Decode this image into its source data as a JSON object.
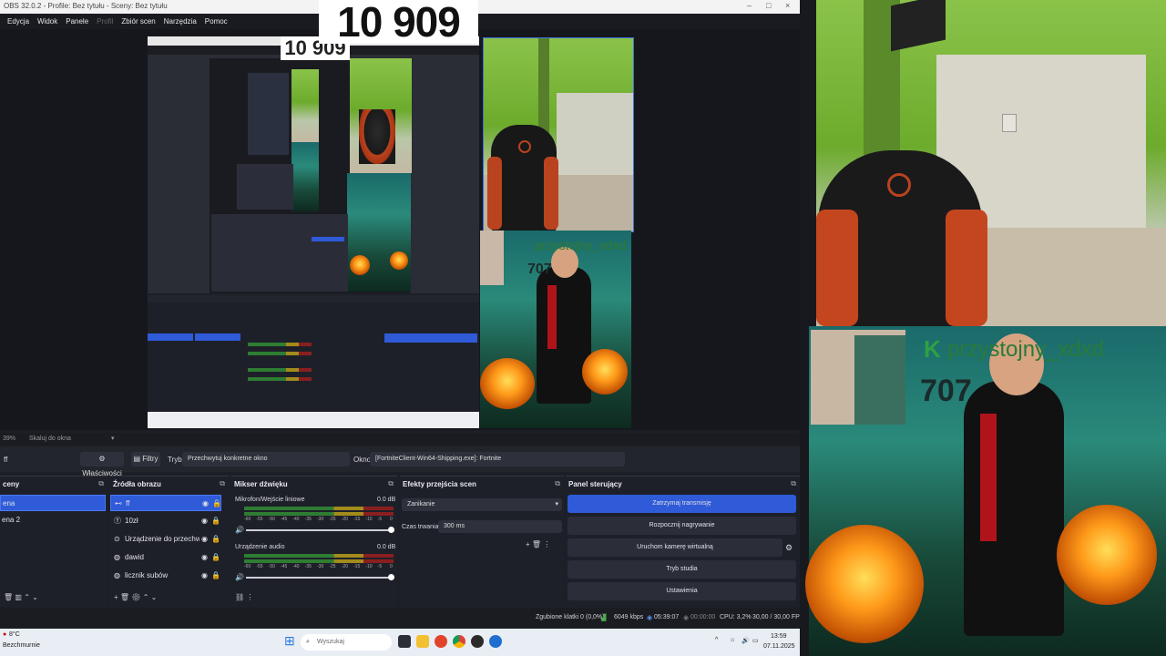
{
  "window": {
    "title": "OBS 32.0.2 - Profile: Bez tytułu - Sceny: Bez tytułu",
    "controls": [
      "–",
      "□",
      "×"
    ]
  },
  "menu": {
    "items": [
      "Edycja",
      "Widok",
      "Panele",
      "Profil",
      "Zbiór scen",
      "Narzędzia",
      "Pomoc"
    ]
  },
  "overlay": {
    "counter_text": "10 909",
    "small_counter_text": "10 909",
    "sticker_name": "przystojny_xdxd",
    "sticker_count": "707"
  },
  "controls_strip": {
    "zoom_label": "Skaluj do okna",
    "zoom_percent": "39%"
  },
  "properties": {
    "source_name": "ff",
    "props_button": "Właściwości",
    "filters_button": "Filtry",
    "mode_label": "Tryb",
    "mode_value": "Przechwytuj konkretne okno",
    "window_label": "Okno",
    "window_value": "[FortniteClient-Win64-Shipping.exe]: Fortnite"
  },
  "scenes": {
    "title": "ceny",
    "items": [
      {
        "label": "ena",
        "selected": true
      },
      {
        "label": "ena 2",
        "selected": false
      }
    ]
  },
  "sources": {
    "title": "Źródła obrazu",
    "items": [
      {
        "label": "ff",
        "selected": true
      },
      {
        "label": "10zł",
        "selected": false
      },
      {
        "label": "Urządzenie do przechwytywani",
        "selected": false
      },
      {
        "label": "dawid",
        "selected": false
      },
      {
        "label": "licznik subów",
        "selected": false
      }
    ]
  },
  "mixer": {
    "title": "Mikser dźwięku",
    "channels": [
      {
        "name": "Mikrofon/Wejście liniowe",
        "db": "0.0 dB"
      },
      {
        "name": "Urządzenie audio",
        "db": "0.0 dB"
      }
    ],
    "ticks": [
      "-60",
      "-55",
      "-50",
      "-45",
      "-40",
      "-35",
      "-30",
      "-25",
      "-20",
      "-15",
      "-10",
      "-5",
      "0"
    ]
  },
  "transitions": {
    "title": "Efekty przejścia scen",
    "type_value": "Zanikanie",
    "duration_label": "Czas trwania",
    "duration_value": "300 ms"
  },
  "controls": {
    "title": "Panel sterujący",
    "buttons": [
      {
        "label": "Zatrzymaj transmisję",
        "primary": true
      },
      {
        "label": "Rozpocznij nagrywanie",
        "primary": false
      },
      {
        "label": "Uruchom kamerę wirtualną",
        "primary": false
      },
      {
        "label": "Tryb studia",
        "primary": false
      },
      {
        "label": "Ustawienia",
        "primary": false
      }
    ]
  },
  "status": {
    "dropped": "Zgubione klatki 0 (0,0%)",
    "bitrate": "6049 kbps",
    "stream_time": "05:39:07",
    "rec_time": "00:00:00",
    "cpu": "CPU: 3,2%",
    "fps": "30,00 / 30,00 FPS"
  },
  "taskbar": {
    "weather_temp": "8°C",
    "weather_desc": "Bezchmurnie",
    "search_placeholder": "Wyszukaj",
    "time": "13:59",
    "date": "07.11.2025"
  },
  "colors": {
    "accent": "#2f5ad8",
    "panel_bg": "#1e2029",
    "window_bg": "#1d1f26"
  }
}
